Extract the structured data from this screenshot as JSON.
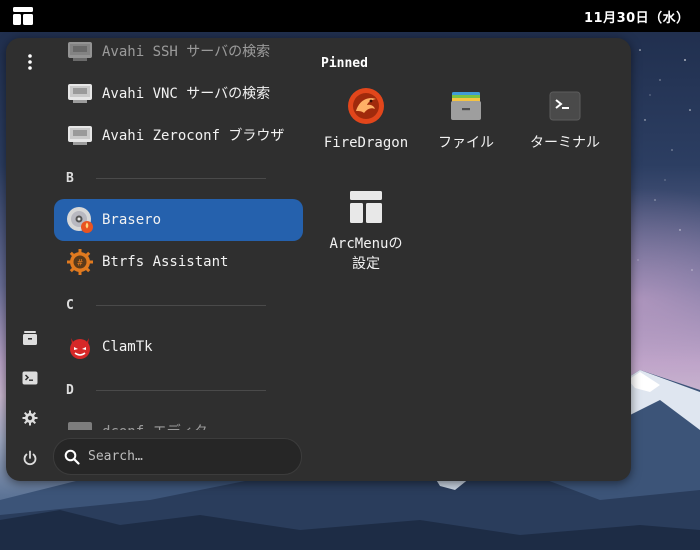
{
  "topbar": {
    "clock": "11月30日（水）"
  },
  "menu": {
    "applist": [
      {
        "type": "app",
        "label": "Avahi SSH サーバの検索",
        "icon": "network-monitor-icon",
        "faded": true
      },
      {
        "type": "app",
        "label": "Avahi VNC サーバの検索",
        "icon": "network-monitor-icon"
      },
      {
        "type": "app",
        "label": "Avahi Zeroconf ブラウザ",
        "icon": "network-monitor-icon"
      },
      {
        "type": "section",
        "label": "B"
      },
      {
        "type": "app",
        "label": "Brasero",
        "icon": "brasero-disc-icon",
        "selected": true
      },
      {
        "type": "app",
        "label": "Btrfs Assistant",
        "icon": "btrfs-gear-icon"
      },
      {
        "type": "section",
        "label": "C"
      },
      {
        "type": "app",
        "label": "ClamTk",
        "icon": "clamtk-devil-icon"
      },
      {
        "type": "section",
        "label": "D"
      },
      {
        "type": "app",
        "label": "dconf エディタ",
        "icon": "dconf-editor-icon",
        "faded": true
      }
    ],
    "search": {
      "placeholder": "Search…",
      "value": ""
    },
    "pinned": {
      "title": "Pinned",
      "items": [
        {
          "label": "FireDragon",
          "icon": "firedragon-icon"
        },
        {
          "label": "ファイル",
          "icon": "files-folder-icon"
        },
        {
          "label": "ターミナル",
          "icon": "terminal-icon"
        },
        {
          "label": "ArcMenuの設定",
          "icon": "arcmenu-layout-icon"
        }
      ]
    },
    "sidebar": [
      "more-options-icon",
      "files-icon",
      "terminal-icon",
      "settings-gear-icon",
      "power-icon"
    ]
  },
  "colors": {
    "accent": "#2561ad",
    "panel": "#2f2f2f",
    "topbar": "#000000"
  }
}
